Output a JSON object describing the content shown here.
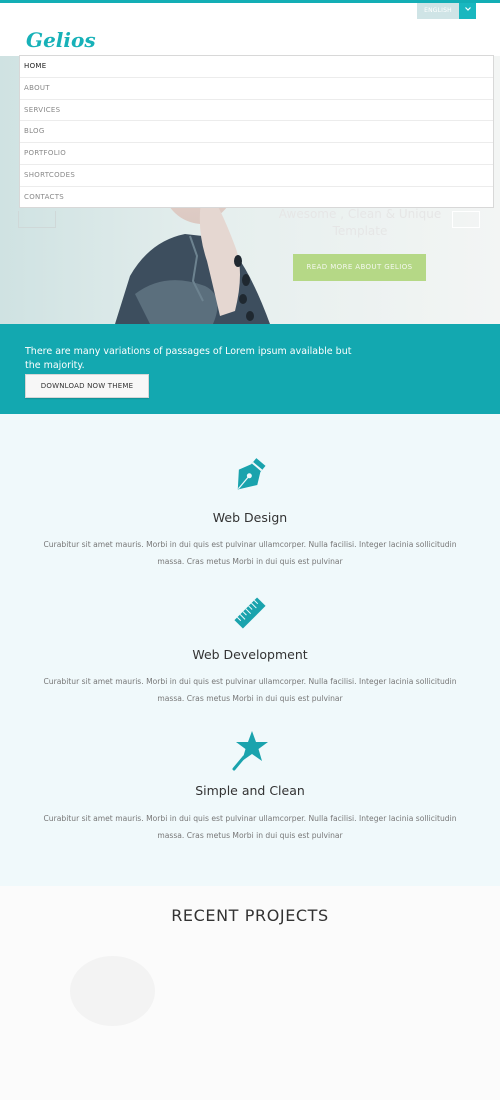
{
  "header": {
    "logo": "Gelios",
    "language": {
      "label": "ENGLISH",
      "icon": "chevron-down-icon"
    }
  },
  "nav": {
    "items": [
      {
        "label": "HOME",
        "active": true
      },
      {
        "label": "ABOUT"
      },
      {
        "label": "SERVICES"
      },
      {
        "label": "BLOG"
      },
      {
        "label": "PORTFOLIO"
      },
      {
        "label": "SHORTCODES"
      },
      {
        "label": "CONTACTS"
      }
    ]
  },
  "hero": {
    "headline": "Awesome , Clean & Unique Template",
    "cta_label": "READ MORE ABOUT GELIOS"
  },
  "banner": {
    "text": "There are many variations of passages of Lorem ipsum available but the majority.",
    "button_label": "DOWNLOAD NOW THEME"
  },
  "features": [
    {
      "icon": "pen-nib-icon",
      "title": "Web Design",
      "description": "Curabitur sit amet mauris. Morbi in dui quis est pulvinar ullamcorper. Nulla facilisi. Integer lacinia sollicitudin massa. Cras metus Morbi in dui quis est pulvinar"
    },
    {
      "icon": "ruler-icon",
      "title": "Web Development",
      "description": "Curabitur sit amet mauris. Morbi in dui quis est pulvinar ullamcorper. Nulla facilisi. Integer lacinia sollicitudin massa. Cras metus Morbi in dui quis est pulvinar"
    },
    {
      "icon": "magic-wand-star-icon",
      "title": "Simple and Clean",
      "description": "Curabitur sit amet mauris. Morbi in dui quis est pulvinar ullamcorper. Nulla facilisi. Integer lacinia sollicitudin massa. Cras metus Morbi in dui quis est pulvinar"
    }
  ],
  "recent_projects": {
    "heading": "RECENT PROJECTS"
  },
  "colors": {
    "accent": "#13a8b0",
    "cta": "#b5d886",
    "features_bg": "#f0f9fb"
  }
}
